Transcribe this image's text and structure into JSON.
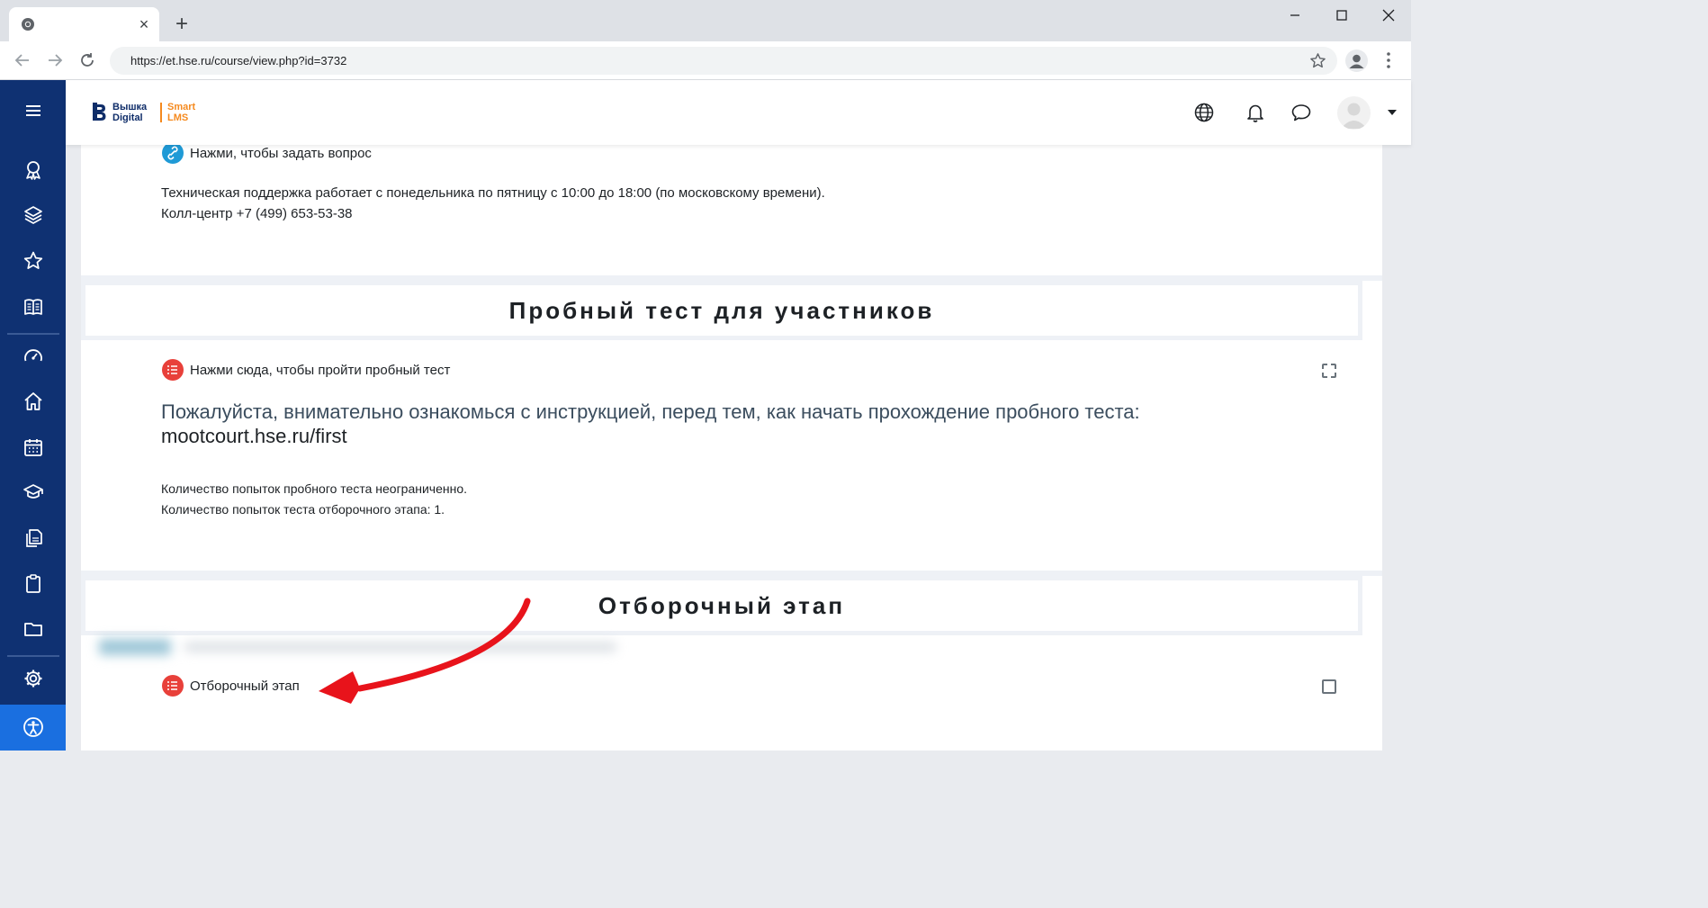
{
  "browser": {
    "tab": {
      "close_glyph": "×"
    },
    "new_tab_glyph": "+",
    "url": "https://et.hse.ru/course/view.php?id=3732"
  },
  "navbar": {
    "logo": {
      "line1": "Вышка",
      "line2": "Digital",
      "right1": "Smart",
      "right2": "LMS"
    },
    "icons": [
      "globe-icon",
      "bell-icon",
      "chat-icon",
      "user-avatar-icon",
      "caret-down-icon"
    ]
  },
  "sidebar": {
    "icons": [
      "menu-icon",
      "award-icon",
      "layers-icon",
      "star-icon",
      "book-icon",
      "dashboard-icon",
      "home-icon",
      "calendar-icon",
      "graduation-cap-icon",
      "files-icon",
      "clipboard-icon",
      "folder-icon",
      "gear-icon",
      "accessibility-icon"
    ],
    "accent": "#0f3172"
  },
  "content": {
    "ask_question_link": "Нажми, чтобы задать вопрос",
    "support_hours": "Техническая поддержка работает с понедельника по пятницу с 10:00 до 18:00 (по московскому времени).",
    "call_center": "Колл-центр +7 (499) 653-53-38",
    "section_trial": {
      "title": "Пробный тест для участников",
      "activity_link": "Нажми сюда, чтобы пройти пробный тест",
      "instruction": "Пожалуйста, внимательно ознакомься с инструкцией, перед тем, как начать прохождение пробного теста:",
      "instruction_url": "mootcourt.hse.ru/first",
      "attempts_trial": "Количество попыток пробного теста неограниченно.",
      "attempts_final": "Количество попыток теста отборочного этапа: 1."
    },
    "section_selection": {
      "title": "Отборочный этап",
      "activity_link": "Отборочный этап"
    }
  },
  "colors": {
    "quiz_icon": "#e8403a",
    "url_icon": "#1f9ad6",
    "arrow": "#e8131b",
    "logo_blue": "#0f2d69",
    "logo_orange": "#f58a1f"
  }
}
